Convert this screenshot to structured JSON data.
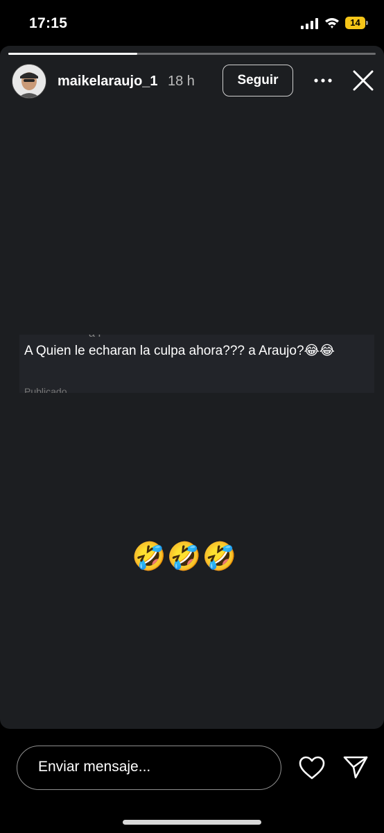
{
  "status_bar": {
    "time": "17:15",
    "battery": "14",
    "battery_color": "#f5c518"
  },
  "story": {
    "progress": 0.35,
    "username": "maikelaraujo_1",
    "time_ago": "18 h",
    "follow_label": "Seguir",
    "more_icon": "more-horizontal-icon",
    "close_icon": "close-icon",
    "tweet_ghost_top": "á F",
    "tweet_text": "A Quien le echaran la culpa ahora??? a Araujo?😂😂",
    "tweet_ghost_bottom": "Publicado",
    "emoji_line": "🤣🤣🤣"
  },
  "bottom_bar": {
    "message_placeholder": "Enviar mensaje...",
    "like_icon": "heart-icon",
    "share_icon": "send-icon"
  }
}
